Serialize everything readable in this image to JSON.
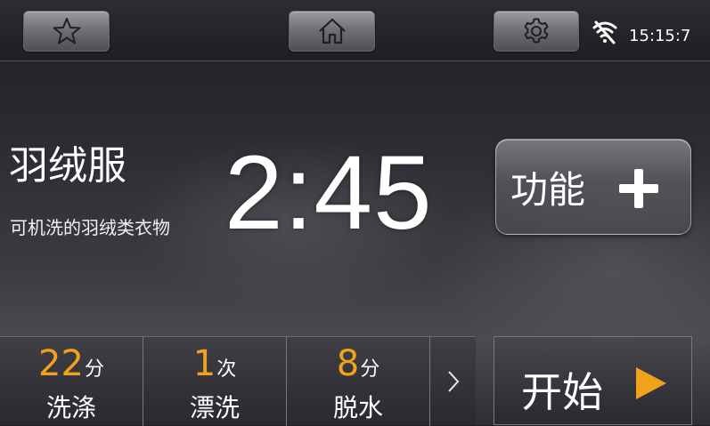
{
  "topbar": {
    "favorite_icon": "star-icon",
    "home_icon": "home-icon",
    "settings_icon": "gear-icon",
    "wifi_icon": "wifi-off-icon",
    "time": "15:15:7"
  },
  "program": {
    "name": "羽绒服",
    "description": "可机洗的羽绒类衣物",
    "remaining_time": "2:45"
  },
  "function_button": {
    "label": "功能",
    "icon": "plus-icon"
  },
  "settings": [
    {
      "value": "22",
      "unit": "分",
      "label": "洗涤"
    },
    {
      "value": "1",
      "unit": "次",
      "label": "漂洗"
    },
    {
      "value": "8",
      "unit": "分",
      "label": "脱水"
    }
  ],
  "next_icon": "chevron-right-icon",
  "start_button": {
    "label": "开始",
    "icon": "play-icon"
  },
  "colors": {
    "accent": "#f0a21c",
    "text": "#ffffff"
  }
}
